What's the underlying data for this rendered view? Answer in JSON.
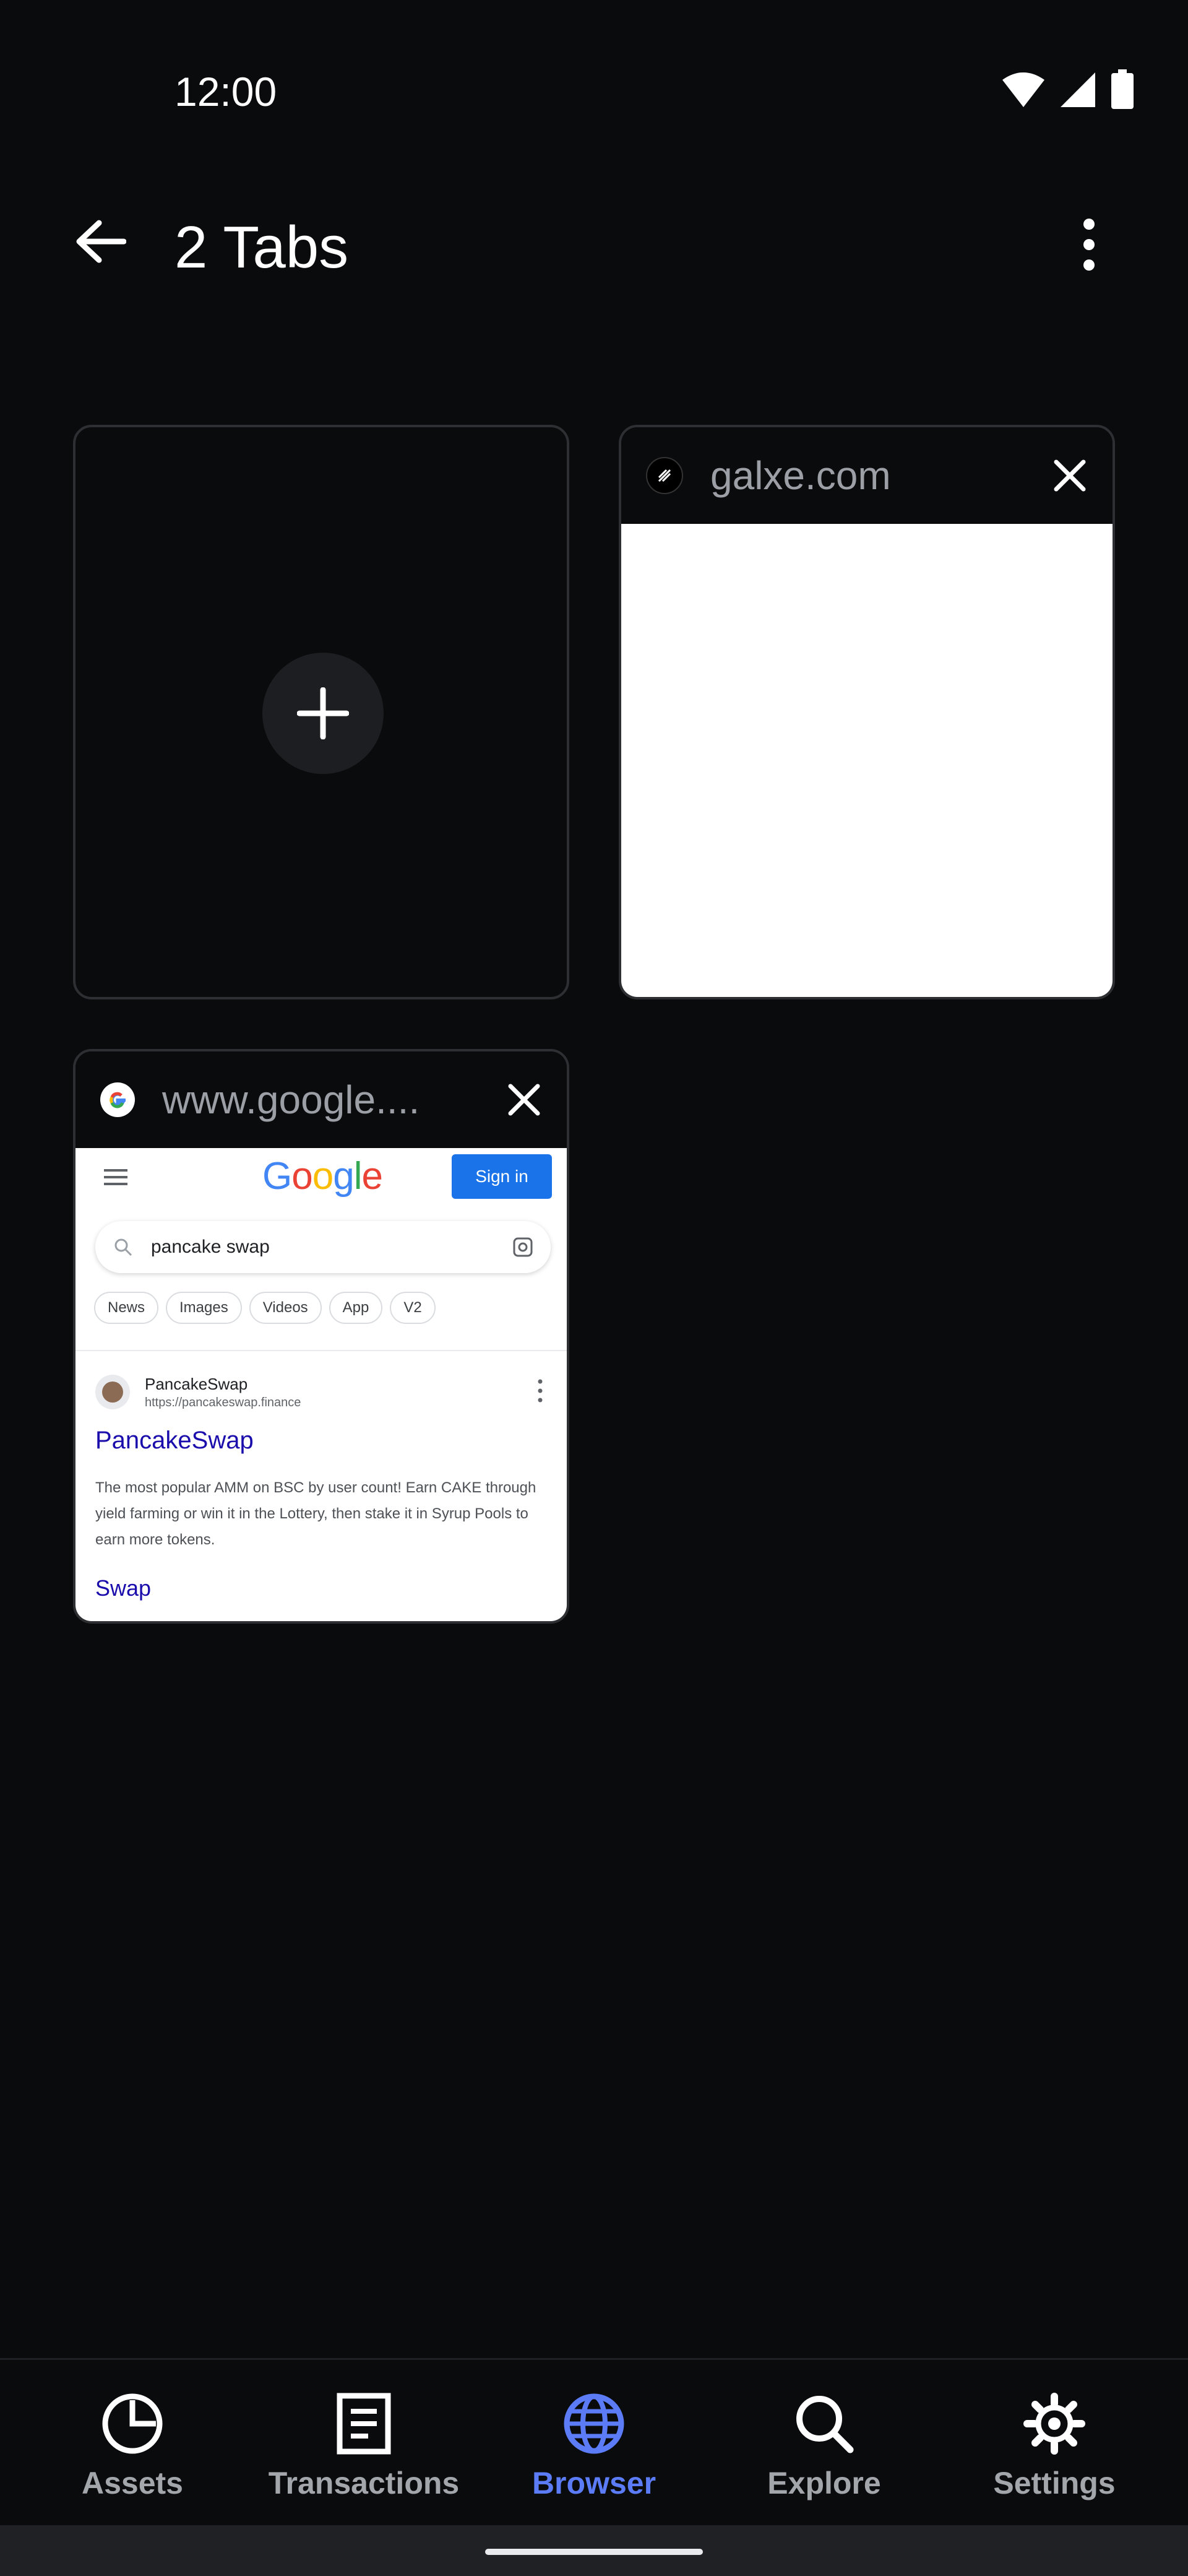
{
  "status_bar": {
    "time": "12:00",
    "icons": [
      "wifi-icon",
      "cellular-signal-icon",
      "battery-icon"
    ]
  },
  "app_bar": {
    "title": "2 Tabs",
    "back_icon": "arrow-left-icon",
    "menu_icon": "more-vert-icon"
  },
  "tabs": [
    {
      "kind": "new-tab",
      "icon": "plus-icon"
    },
    {
      "kind": "page",
      "title": "galxe.com",
      "favicon": "galxe-favicon",
      "close_icon": "close-icon"
    },
    {
      "kind": "page",
      "title": "www.google....",
      "favicon": "google-favicon",
      "close_icon": "close-icon",
      "preview": {
        "logo": "Google",
        "sign_in": "Sign in",
        "query": "pancake swap",
        "chips": [
          "News",
          "Images",
          "Videos",
          "App",
          "V2"
        ],
        "result_site": "PancakeSwap",
        "result_url": "https://pancakeswap.finance",
        "result_title": "PancakeSwap",
        "result_desc": "The most popular AMM on BSC by user count! Earn CAKE through yield farming or win it in the Lottery, then stake it in Syrup Pools to earn more tokens.",
        "result_link": "Swap"
      }
    }
  ],
  "bottom_nav": {
    "items": [
      {
        "label": "Assets",
        "icon": "pie-chart-icon",
        "active": false
      },
      {
        "label": "Transactions",
        "icon": "receipt-icon",
        "active": false
      },
      {
        "label": "Browser",
        "icon": "globe-icon",
        "active": true
      },
      {
        "label": "Explore",
        "icon": "search-icon",
        "active": false
      },
      {
        "label": "Settings",
        "icon": "gear-icon",
        "active": false
      }
    ]
  },
  "colors": {
    "background": "#0a0b0d",
    "accent": "#5b7cf6",
    "inactive": "#a3a6ab",
    "card_border": "#2d2f33"
  }
}
